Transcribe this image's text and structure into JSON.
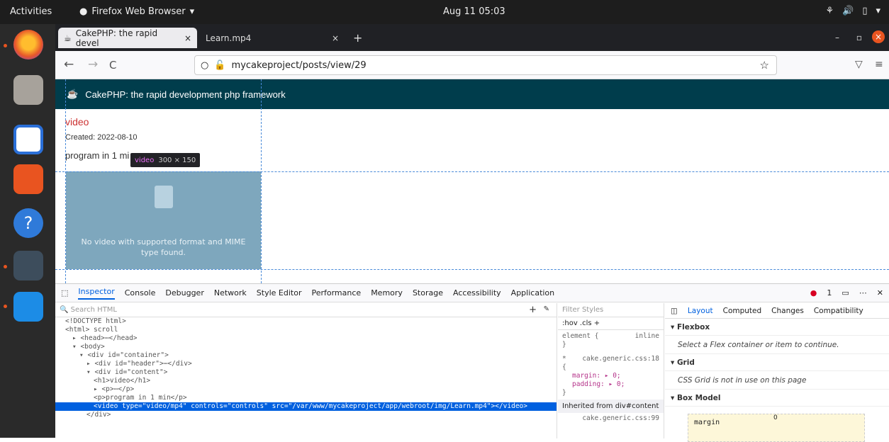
{
  "topbar": {
    "activities": "Activities",
    "app_name": "Firefox Web Browser",
    "app_menu": "▾",
    "clock": "Aug 11 05:03",
    "tray": [
      "network-icon",
      "volume-icon",
      "battery-icon",
      "menu-icon"
    ]
  },
  "dock": {
    "apps": [
      "firefox",
      "files",
      "writer",
      "software",
      "help",
      "dbeaver",
      "vscode"
    ]
  },
  "tabs": [
    {
      "label": "CakePHP: the rapid devel",
      "close": "×"
    },
    {
      "label": "Learn.mp4",
      "close": "×"
    }
  ],
  "new_tab": "+",
  "window_controls": {
    "minimize": "–",
    "restore": "▫",
    "close": "×"
  },
  "navbar": {
    "back": "←",
    "forward": "→",
    "reload": "C",
    "url": "mycakeproject/posts/view/29",
    "bookmark": "☆",
    "pocket": "▽",
    "menu": "≡"
  },
  "page": {
    "header_title": "CakePHP: the rapid development php framework",
    "post_title": "video",
    "created": "Created: 2022-08-10",
    "body": "program in 1 mi",
    "tooltip_tag": "video",
    "tooltip_size": "300 × 150",
    "video_error": "No video with supported format and MIME type found."
  },
  "devtools": {
    "tabs": [
      "Inspector",
      "Console",
      "Debugger",
      "Network",
      "Style Editor",
      "Performance",
      "Memory",
      "Storage",
      "Accessibility",
      "Application"
    ],
    "error_count": "1",
    "search_placeholder": "Search HTML",
    "markup": [
      {
        "indent": 0,
        "text": "<!DOCTYPE html>"
      },
      {
        "indent": 0,
        "text": "<html> scroll"
      },
      {
        "indent": 1,
        "text": "▸ <head>⋯</head>"
      },
      {
        "indent": 1,
        "text": "▾ <body>"
      },
      {
        "indent": 2,
        "text": "▾ <div id=\"container\">"
      },
      {
        "indent": 3,
        "text": "▸ <div id=\"header\">⋯</div>"
      },
      {
        "indent": 3,
        "text": "▾ <div id=\"content\">"
      },
      {
        "indent": 4,
        "text": "<h1>video</h1>"
      },
      {
        "indent": 4,
        "text": "▸ <p>⋯</p>"
      },
      {
        "indent": 4,
        "text": "<p>program in 1 min</p>"
      },
      {
        "indent": 4,
        "text": "<video type=\"video/mp4\" controls=\"controls\" src=\"/var/www/mycakeproject/app/webroot/img/Learn.mp4\"></video>",
        "highlight": true
      },
      {
        "indent": 3,
        "text": "</div>"
      }
    ],
    "rules": {
      "filter_placeholder": "Filter Styles",
      "toolbar": ":hov .cls +",
      "element_rule": "element {",
      "element_source": "inline",
      "close": "}",
      "star_rule": "* ",
      "star_source": "cake.generic.css:18",
      "open": "{",
      "margin": "margin: ▸ 0;",
      "padding": "padding: ▸ 0;",
      "inherited": "Inherited from div#content",
      "inherited_source": "cake.generic.css:99"
    },
    "layout": {
      "tabs": [
        "Layout",
        "Computed",
        "Changes",
        "Compatibility"
      ],
      "flexbox_title": "Flexbox",
      "flexbox_note": "Select a Flex container or item to continue.",
      "grid_title": "Grid",
      "grid_note": "CSS Grid is not in use on this page",
      "boxmodel_title": "Box Model",
      "margin_label": "margin",
      "margin_value": "0"
    }
  }
}
